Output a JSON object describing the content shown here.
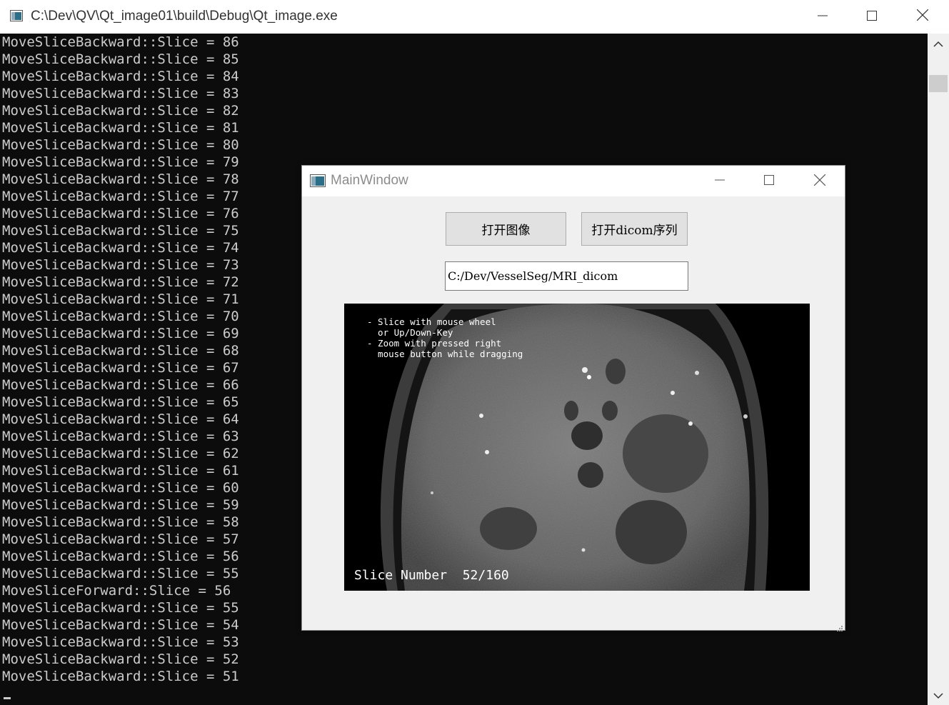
{
  "console": {
    "title": "C:\\Dev\\QV\\Qt_image01\\build\\Debug\\Qt_image.exe",
    "lines": [
      "MoveSliceBackward::Slice = 86",
      "MoveSliceBackward::Slice = 85",
      "MoveSliceBackward::Slice = 84",
      "MoveSliceBackward::Slice = 83",
      "MoveSliceBackward::Slice = 82",
      "MoveSliceBackward::Slice = 81",
      "MoveSliceBackward::Slice = 80",
      "MoveSliceBackward::Slice = 79",
      "MoveSliceBackward::Slice = 78",
      "MoveSliceBackward::Slice = 77",
      "MoveSliceBackward::Slice = 76",
      "MoveSliceBackward::Slice = 75",
      "MoveSliceBackward::Slice = 74",
      "MoveSliceBackward::Slice = 73",
      "MoveSliceBackward::Slice = 72",
      "MoveSliceBackward::Slice = 71",
      "MoveSliceBackward::Slice = 70",
      "MoveSliceBackward::Slice = 69",
      "MoveSliceBackward::Slice = 68",
      "MoveSliceBackward::Slice = 67",
      "MoveSliceBackward::Slice = 66",
      "MoveSliceBackward::Slice = 65",
      "MoveSliceBackward::Slice = 64",
      "MoveSliceBackward::Slice = 63",
      "MoveSliceBackward::Slice = 62",
      "MoveSliceBackward::Slice = 61",
      "MoveSliceBackward::Slice = 60",
      "MoveSliceBackward::Slice = 59",
      "MoveSliceBackward::Slice = 58",
      "MoveSliceBackward::Slice = 57",
      "MoveSliceBackward::Slice = 56",
      "MoveSliceBackward::Slice = 55",
      "MoveSliceForward::Slice = 56",
      "MoveSliceBackward::Slice = 55",
      "MoveSliceBackward::Slice = 54",
      "MoveSliceBackward::Slice = 53",
      "MoveSliceBackward::Slice = 52",
      "MoveSliceBackward::Slice = 51"
    ]
  },
  "main_window": {
    "title": "MainWindow",
    "open_image_label": "打开图像",
    "open_dicom_label": "打开dicom序列",
    "path_value": "C:/Dev/VesselSeg/MRI_dicom",
    "viewer": {
      "help_lines": [
        "- Slice with mouse wheel",
        "  or Up/Down-Key",
        "- Zoom with pressed right",
        "  mouse button while dragging"
      ],
      "slice_text": "Slice Number  52/160"
    }
  },
  "icons": {
    "minimize": "minimize-icon",
    "maximize": "maximize-icon",
    "close": "close-icon",
    "app": "app-window-icon"
  },
  "colors": {
    "console_bg": "#0c0c0c",
    "console_text": "#cccccc",
    "window_bg": "#f0f0f0",
    "button_bg": "#e1e1e1"
  }
}
